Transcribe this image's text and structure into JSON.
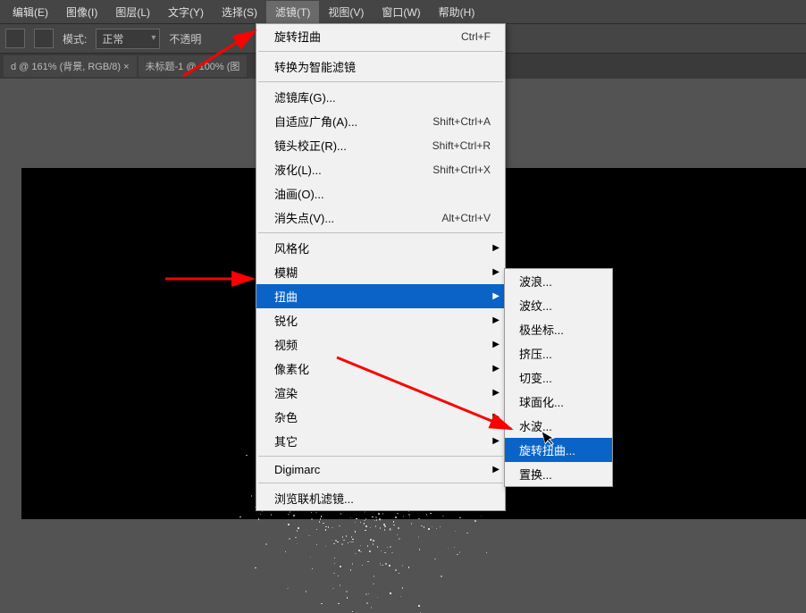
{
  "menubar": {
    "items": [
      {
        "label": "编辑(E)"
      },
      {
        "label": "图像(I)"
      },
      {
        "label": "图层(L)"
      },
      {
        "label": "文字(Y)"
      },
      {
        "label": "选择(S)"
      },
      {
        "label": "滤镜(T)",
        "active": true
      },
      {
        "label": "视图(V)"
      },
      {
        "label": "窗口(W)"
      },
      {
        "label": "帮助(H)"
      }
    ]
  },
  "toolbar": {
    "mode_label": "模式:",
    "mode_value": "正常",
    "opacity_label": "不透明"
  },
  "tabs": {
    "items": [
      {
        "label": "d @ 161% (背景, RGB/8) ×"
      },
      {
        "label": "未标题-1 @ 100% (图"
      }
    ]
  },
  "filter_menu": {
    "items": [
      {
        "label": "旋转扭曲",
        "shortcut": "Ctrl+F"
      },
      {
        "type": "sep"
      },
      {
        "label": "转换为智能滤镜"
      },
      {
        "type": "sep"
      },
      {
        "label": "滤镜库(G)..."
      },
      {
        "label": "自适应广角(A)...",
        "shortcut": "Shift+Ctrl+A"
      },
      {
        "label": "镜头校正(R)...",
        "shortcut": "Shift+Ctrl+R"
      },
      {
        "label": "液化(L)...",
        "shortcut": "Shift+Ctrl+X"
      },
      {
        "label": "油画(O)..."
      },
      {
        "label": "消失点(V)...",
        "shortcut": "Alt+Ctrl+V"
      },
      {
        "type": "sep"
      },
      {
        "label": "风格化",
        "sub": true
      },
      {
        "label": "模糊",
        "sub": true
      },
      {
        "label": "扭曲",
        "sub": true,
        "highlighted": true
      },
      {
        "label": "锐化",
        "sub": true
      },
      {
        "label": "视频",
        "sub": true
      },
      {
        "label": "像素化",
        "sub": true
      },
      {
        "label": "渲染",
        "sub": true
      },
      {
        "label": "杂色",
        "sub": true
      },
      {
        "label": "其它",
        "sub": true
      },
      {
        "type": "sep"
      },
      {
        "label": "Digimarc",
        "sub": true
      },
      {
        "type": "sep"
      },
      {
        "label": "浏览联机滤镜..."
      }
    ]
  },
  "distort_submenu": {
    "items": [
      {
        "label": "波浪..."
      },
      {
        "label": "波纹..."
      },
      {
        "label": "极坐标..."
      },
      {
        "label": "挤压..."
      },
      {
        "label": "切变..."
      },
      {
        "label": "球面化..."
      },
      {
        "label": "水波..."
      },
      {
        "label": "旋转扭曲...",
        "highlighted": true
      },
      {
        "label": "置换..."
      }
    ]
  }
}
